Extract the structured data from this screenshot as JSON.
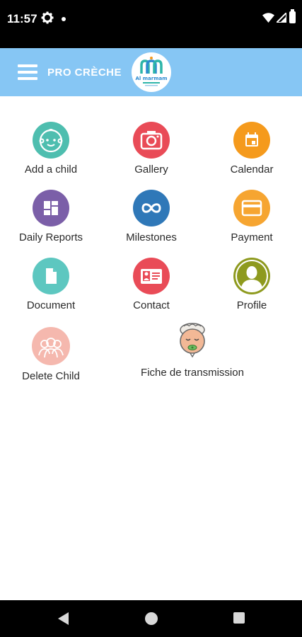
{
  "status": {
    "time": "11:57",
    "icons": [
      "settings-gear-icon",
      "notification-dot-icon",
      "wifi-icon",
      "cell-signal-icon",
      "battery-icon"
    ]
  },
  "header": {
    "menu_icon": "hamburger-menu-icon",
    "title": "PRO CRÈCHE",
    "logo_text": "Al marmam",
    "background": "#86c6f4"
  },
  "menu": {
    "items": [
      {
        "label": "Add a child",
        "icon": "baby-face-icon",
        "color": "#4ebeaf"
      },
      {
        "label": "Gallery",
        "icon": "camera-icon",
        "color": "#e94b57"
      },
      {
        "label": "Calendar",
        "icon": "calendar-icon",
        "color": "#f59a1c"
      },
      {
        "label": "Daily Reports",
        "icon": "dashboard-grid-icon",
        "color": "#7b5fa8"
      },
      {
        "label": "Milestones",
        "icon": "infinity-icon",
        "color": "#2f78b8"
      },
      {
        "label": "Payment",
        "icon": "credit-card-icon",
        "color": "#f6a531"
      },
      {
        "label": "Document",
        "icon": "document-icon",
        "color": "#5dc7c0"
      },
      {
        "label": "Contact",
        "icon": "contact-card-icon",
        "color": "#e94b57"
      },
      {
        "label": "Profile",
        "icon": "user-silhouette-icon",
        "color": "#8e9a1e"
      },
      {
        "label": "Delete Child",
        "icon": "children-group-icon",
        "color": "#f5b8ae"
      },
      {
        "label": "Fiche de transmission",
        "icon": "sleeping-baby-icon",
        "color": "#f2b896"
      }
    ]
  },
  "navigation": {
    "icons": [
      "back-triangle-icon",
      "home-circle-icon",
      "recent-apps-square-icon"
    ]
  }
}
